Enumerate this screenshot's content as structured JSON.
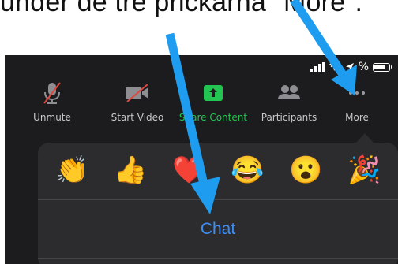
{
  "caption": "under de tre prickarna \"More\".",
  "status": {
    "battery": "%"
  },
  "toolbar": {
    "unmute": "Unmute",
    "start_video": "Start Video",
    "share_content": "Share Content",
    "participants": "Participants",
    "more": "More"
  },
  "reactions": {
    "clap": "👏",
    "thumbs_up": "👍",
    "heart": "❤️",
    "joy": "😂",
    "wow": "😮",
    "party": "🎉"
  },
  "menu": {
    "chat": "Chat"
  },
  "colors": {
    "arrow": "#1e9df0",
    "accent": "#3e8ef7",
    "share_green": "#23c552"
  }
}
